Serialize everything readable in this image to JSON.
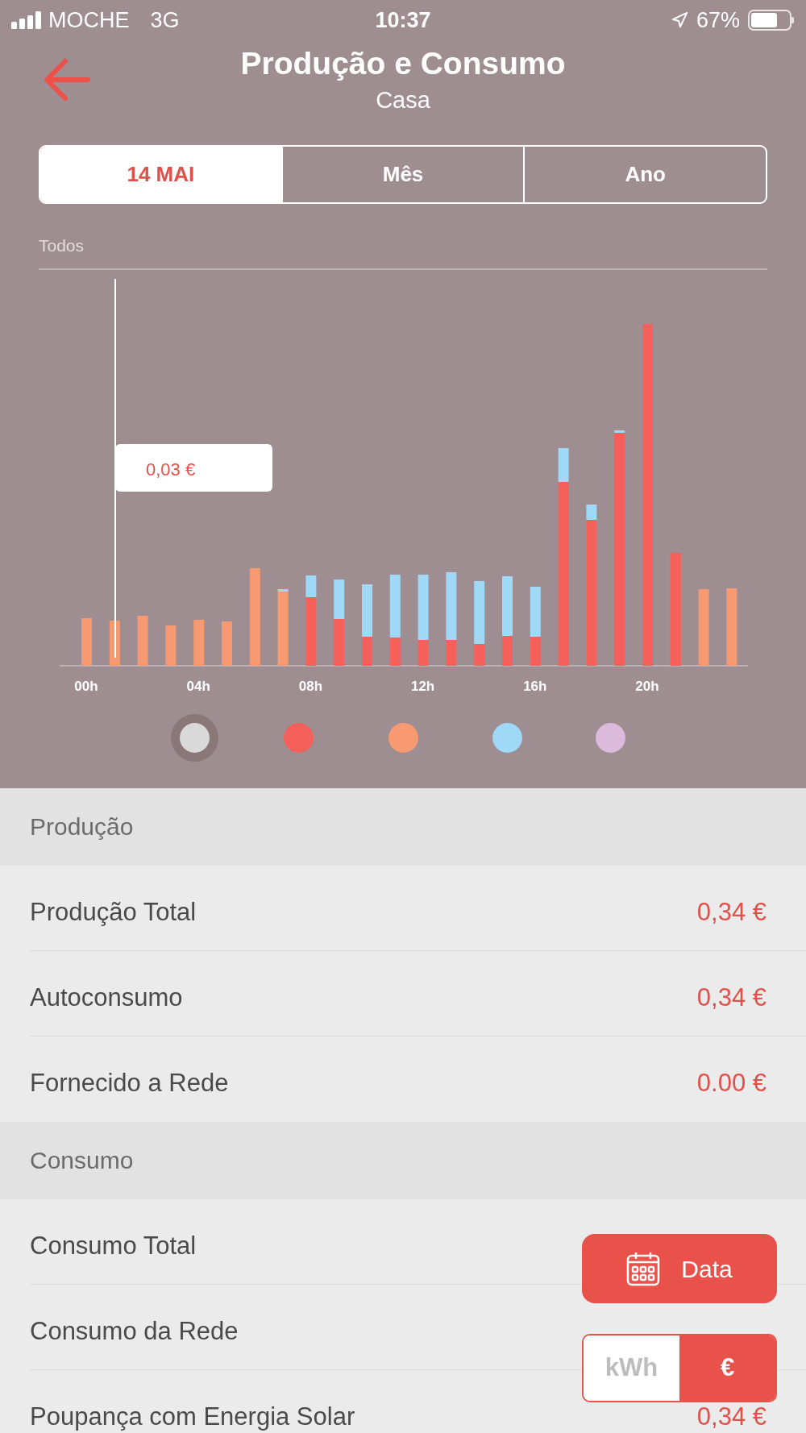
{
  "status_bar": {
    "carrier": "MOCHE",
    "network": "3G",
    "time": "10:37",
    "battery": "67%"
  },
  "header": {
    "title": "Produção e Consumo",
    "subtitle": "Casa"
  },
  "tabs": [
    {
      "label": "14 MAI",
      "selected": true
    },
    {
      "label": "Mês",
      "selected": false
    },
    {
      "label": "Ano",
      "selected": false
    }
  ],
  "filter_label": "Todos",
  "chart": {
    "tooltip": "0,03 €",
    "x_labels": [
      "00h",
      "04h",
      "08h",
      "12h",
      "16h",
      "20h"
    ],
    "legend": [
      {
        "color": "#d9d9d9",
        "selected": true
      },
      {
        "color": "#f5605a",
        "selected": false
      },
      {
        "color": "#f79a72",
        "selected": false
      },
      {
        "color": "#a0d8f8",
        "selected": false
      },
      {
        "color": "#dbbadc",
        "selected": false
      }
    ]
  },
  "sections": [
    {
      "title": "Produção",
      "rows": [
        {
          "label": "Produção Total",
          "value": "0,34 €"
        },
        {
          "label": "Autoconsumo",
          "value": "0,34 €"
        },
        {
          "label": "Fornecido a Rede",
          "value": "0.00 €"
        }
      ]
    },
    {
      "title": "Consumo",
      "rows": [
        {
          "label": "Consumo Total"
        },
        {
          "label": "Consumo da Rede"
        },
        {
          "label": "Poupança com Energia Solar",
          "value": "0,34 €"
        }
      ]
    }
  ],
  "date_button": "Data",
  "unit_toggle": [
    {
      "label": "kWh",
      "selected": false
    },
    {
      "label": "€",
      "selected": true
    }
  ]
}
